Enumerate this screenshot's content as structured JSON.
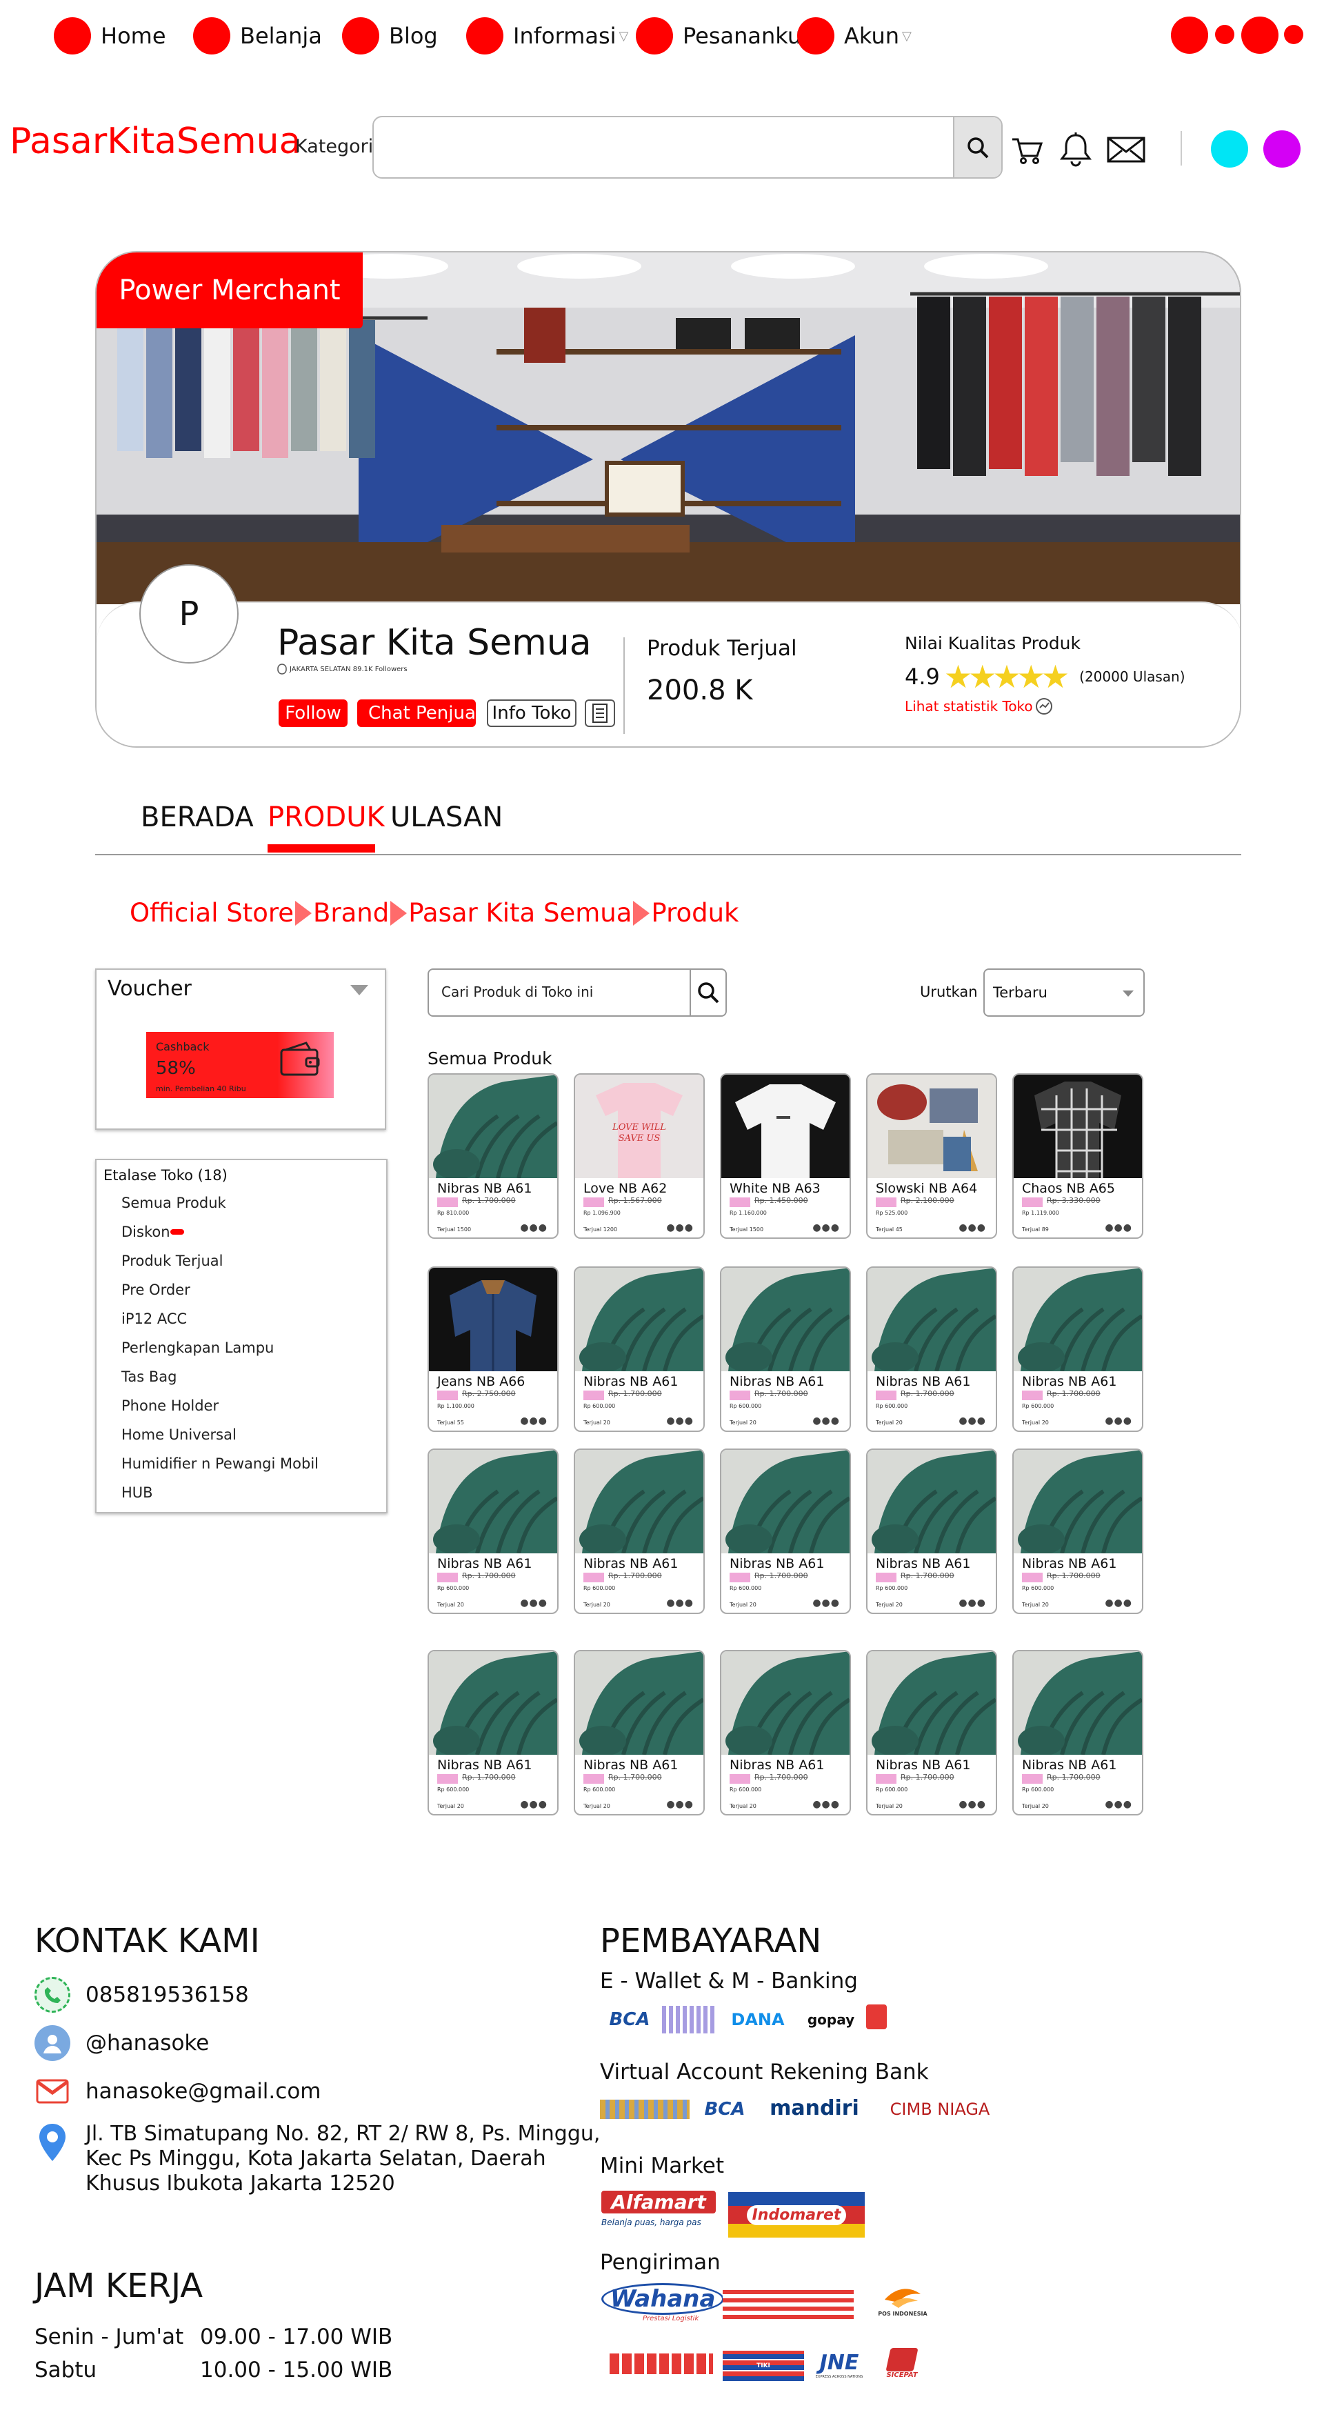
{
  "nav": {
    "items": [
      {
        "label": "Home"
      },
      {
        "label": "Belanja"
      },
      {
        "label": "Blog"
      },
      {
        "label": "Informasi"
      },
      {
        "label": "Pesananku"
      },
      {
        "label": "Akun"
      }
    ]
  },
  "header": {
    "logo": "PasarKitaSemua",
    "category_label": "Kategori",
    "search_placeholder": ""
  },
  "banner": {
    "badge": "Power Merchant",
    "avatar_letter": "P",
    "store_name": "Pasar Kita Semua",
    "store_sub": "JAKARTA SELATAN 89.1K Followers",
    "follow_button": "Follow",
    "chat_button": "Chat Penjual",
    "info_button": "Info Toko",
    "sold_label": "Produk Terjual",
    "sold_value": "200.8 K",
    "quality_label": "Nilai Kualitas Produk",
    "rating_value": "4.9",
    "rating_stars": 5,
    "review_count": "(20000 Ulasan)",
    "stats_link": "Lihat statistik Toko"
  },
  "tabs": [
    {
      "label": "BERADA",
      "active": false
    },
    {
      "label": "PRODUK",
      "active": true
    },
    {
      "label": "ULASAN",
      "active": false
    }
  ],
  "breadcrumb": [
    "Official Store",
    "Brand",
    "Pasar Kita Semua",
    "Produk"
  ],
  "voucher": {
    "title": "Voucher",
    "cashback_label": "Cashback",
    "cashback_value": "58%",
    "cashback_note": "min. Pembelian 40 Ribu"
  },
  "etalase": {
    "title": "Etalase Toko (18)",
    "items": [
      "Semua Produk",
      "Diskon",
      "Produk Terjual",
      "Pre Order",
      "iP12 ACC",
      "Perlengkapan Lampu",
      "Tas Bag",
      "Phone Holder",
      "Home Universal",
      "Humidifier n Pewangi Mobil",
      "HUB"
    ]
  },
  "product_search": {
    "placeholder": "Cari Produk di Toko ini",
    "sort_label": "Urutkan",
    "sort_value": "Terbaru"
  },
  "products_title": "Semua Produk",
  "products": [
    {
      "name": "Nibras NB A61",
      "old": "Rp. 1.700.000",
      "price": "Rp 810.000",
      "sold": "Terjual 1500",
      "img": "green-sweater"
    },
    {
      "name": "Love NB A62",
      "old": "Rp. 1.567.000",
      "price": "Rp 1.096.900",
      "sold": "Terjual 1200",
      "img": "pink-shirt"
    },
    {
      "name": "White NB A63",
      "old": "Rp. 1.450.000",
      "price": "Rp 1.160.000",
      "sold": "Terjual 1500",
      "img": "white-shirt"
    },
    {
      "name": "Slowski NB A64",
      "old": "Rp. 2.100.000",
      "price": "Rp 525.000",
      "sold": "Terjual 45",
      "img": "clothes-flat"
    },
    {
      "name": "Chaos NB A65",
      "old": "Rp. 3.330.000",
      "price": "Rp 1.119.000",
      "sold": "Terjual 89",
      "img": "plaid-shirt"
    },
    {
      "name": "Jeans NB A66",
      "old": "Rp. 2.750.000",
      "price": "Rp 1.100.000",
      "sold": "Terjual 55",
      "img": "denim-jacket"
    },
    {
      "name": "Nibras NB A61",
      "old": "Rp. 1.700.000",
      "price": "Rp 600.000",
      "sold": "Terjual 20",
      "img": "green-sweater"
    },
    {
      "name": "Nibras NB A61",
      "old": "Rp. 1.700.000",
      "price": "Rp 600.000",
      "sold": "Terjual 20",
      "img": "green-sweater"
    },
    {
      "name": "Nibras NB A61",
      "old": "Rp. 1.700.000",
      "price": "Rp 600.000",
      "sold": "Terjual 20",
      "img": "green-sweater"
    },
    {
      "name": "Nibras NB A61",
      "old": "Rp. 1.700.000",
      "price": "Rp 600.000",
      "sold": "Terjual 20",
      "img": "green-sweater"
    },
    {
      "name": "Nibras NB A61",
      "old": "Rp. 1.700.000",
      "price": "Rp 600.000",
      "sold": "Terjual 20",
      "img": "green-sweater"
    },
    {
      "name": "Nibras NB A61",
      "old": "Rp. 1.700.000",
      "price": "Rp 600.000",
      "sold": "Terjual 20",
      "img": "green-sweater"
    },
    {
      "name": "Nibras NB A61",
      "old": "Rp. 1.700.000",
      "price": "Rp 600.000",
      "sold": "Terjual 20",
      "img": "green-sweater"
    },
    {
      "name": "Nibras NB A61",
      "old": "Rp. 1.700.000",
      "price": "Rp 600.000",
      "sold": "Terjual 20",
      "img": "green-sweater"
    },
    {
      "name": "Nibras NB A61",
      "old": "Rp. 1.700.000",
      "price": "Rp 600.000",
      "sold": "Terjual 20",
      "img": "green-sweater"
    },
    {
      "name": "Nibras NB A61",
      "old": "Rp. 1.700.000",
      "price": "Rp 600.000",
      "sold": "Terjual 20",
      "img": "green-sweater"
    },
    {
      "name": "Nibras NB A61",
      "old": "Rp. 1.700.000",
      "price": "Rp 600.000",
      "sold": "Terjual 20",
      "img": "green-sweater"
    },
    {
      "name": "Nibras NB A61",
      "old": "Rp. 1.700.000",
      "price": "Rp 600.000",
      "sold": "Terjual 20",
      "img": "green-sweater"
    },
    {
      "name": "Nibras NB A61",
      "old": "Rp. 1.700.000",
      "price": "Rp 600.000",
      "sold": "Terjual 20",
      "img": "green-sweater"
    },
    {
      "name": "Nibras NB A61",
      "old": "Rp. 1.700.000",
      "price": "Rp 600.000",
      "sold": "Terjual 20",
      "img": "green-sweater"
    }
  ],
  "footer": {
    "contact_title": "KONTAK KAMI",
    "phone": "085819536158",
    "social": "@hanasoke",
    "email": "hanasoke@gmail.com",
    "address": [
      "Jl. TB Simatupang No. 82, RT 2/ RW 8, Ps. Minggu,",
      "Kec Ps Minggu, Kota Jakarta Selatan, Daerah",
      "Khusus Ibukota Jakarta 12520"
    ],
    "hours_title": "JAM KERJA",
    "hours": [
      {
        "day": "Senin - Jum'at",
        "time": "09.00 - 17.00 WIB"
      },
      {
        "day": "Sabtu",
        "time": "10.00 - 15.00 WIB"
      }
    ],
    "payment_title": "PEMBAYARAN",
    "ewallet_title": "E - Wallet & M - Banking",
    "va_title": "Virtual Account Rekening Bank",
    "minimarket_title": "Mini Market",
    "shipping_title": "Pengiriman",
    "logos": {
      "bca": "BCA",
      "dana": "DANA",
      "gopay": "gopay",
      "mandiri": "mandiri",
      "cimb": "CIMB NIAGA",
      "alfamart": "Alfamart",
      "alfamart_tag": "Belanja puas, harga pas",
      "indomaret": "Indomaret",
      "wahana": "Wahana",
      "wahana_tag": "Prestasi Logistik",
      "pos": "POS INDONESIA",
      "tiki": "TIKI",
      "jne": "JNE",
      "jne_tag": "EXPRESS ACROSS NATIONS",
      "sicepat": "SICEPAT"
    }
  },
  "colors": {
    "accent": "#ff0000",
    "cyan": "#00e5f5",
    "magenta": "#d400f5",
    "tab_active": "#ff0000"
  }
}
